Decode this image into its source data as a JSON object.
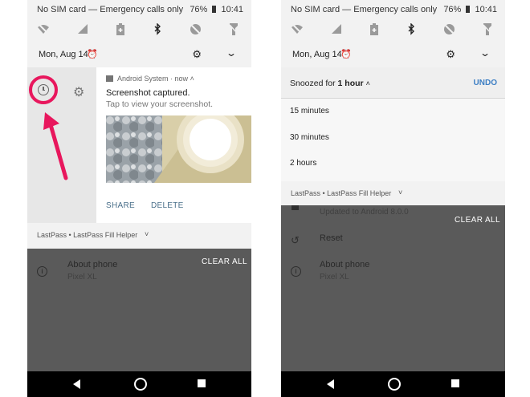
{
  "status_bar": {
    "carrier": "No SIM card — Emergency calls only",
    "battery": "76%",
    "time": "10:41"
  },
  "quick_settings": {
    "date": "Mon, Aug 14"
  },
  "left": {
    "notification": {
      "app": "Android System",
      "time": "now",
      "title": "Screenshot captured.",
      "subtitle": "Tap to view your screenshot.",
      "actions": [
        "SHARE",
        "DELETE"
      ]
    },
    "lastpass": "LastPass • LastPass Fill Helper",
    "about": {
      "title": "About phone",
      "subtitle": "Pixel XL"
    },
    "clear_all": "CLEAR ALL"
  },
  "right": {
    "snooze": {
      "label": "Snoozed for",
      "duration": "1 hour",
      "undo": "UNDO"
    },
    "options": [
      "15 minutes",
      "30 minutes",
      "2 hours"
    ],
    "lastpass": "LastPass • LastPass Fill Helper",
    "updated": "Updated to Android 8.0.0",
    "clear_all": "CLEAR ALL",
    "reset": "Reset",
    "about": {
      "title": "About phone",
      "subtitle": "Pixel XL"
    }
  },
  "colors": {
    "accent_pink": "#e8175d",
    "undo_blue": "#3d7fc4"
  },
  "icons": [
    "wifi-off-icon",
    "signal-icon",
    "battery-saver-icon",
    "bluetooth-icon",
    "do-not-disturb-icon",
    "flashlight-icon",
    "alarm-icon",
    "gear-icon",
    "chevron-down-icon",
    "clock-icon",
    "info-icon",
    "reset-icon",
    "back-icon",
    "home-icon",
    "recents-icon"
  ]
}
